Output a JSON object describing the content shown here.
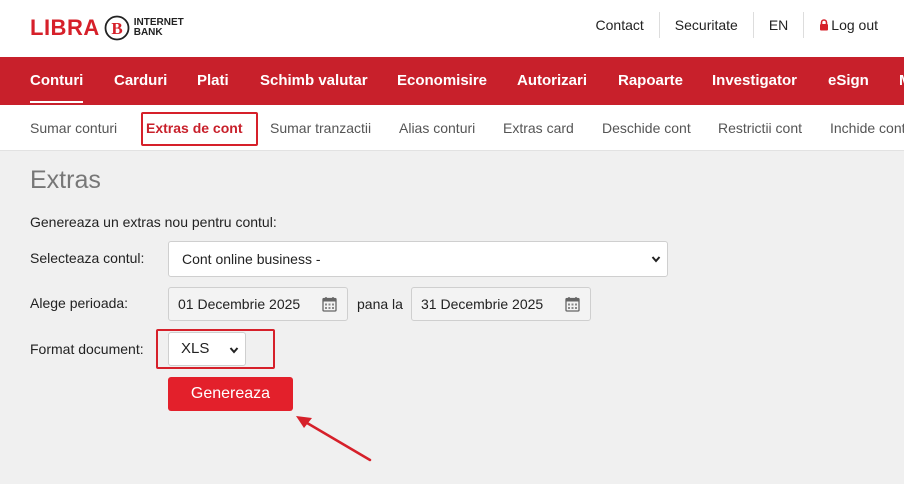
{
  "header": {
    "logo_word": "LIBRA",
    "logo_sub_line1": "INTERNET",
    "logo_sub_line2": "BANK",
    "links": [
      "Contact",
      "Securitate",
      "EN",
      "Log out"
    ]
  },
  "main_nav": {
    "items": [
      "Conturi",
      "Carduri",
      "Plati",
      "Schimb valutar",
      "Economisire",
      "Autorizari",
      "Rapoarte",
      "Investigator",
      "eSign",
      "M"
    ],
    "active": "Conturi"
  },
  "sub_nav": {
    "items": [
      "Sumar conturi",
      "Extras de cont",
      "Sumar tranzactii",
      "Alias conturi",
      "Extras card",
      "Deschide cont",
      "Restrictii cont",
      "Inchide cont"
    ],
    "active": "Extras de cont"
  },
  "page": {
    "title": "Extras",
    "intro": "Genereaza un extras nou pentru contul:",
    "account_label": "Selecteaza contul:",
    "account_value": "Cont online business -",
    "period_label": "Alege perioada:",
    "date_from": "01 Decembrie 2025",
    "between_label": "pana la",
    "date_to": "31 Decembrie 2025",
    "format_label": "Format document:",
    "format_value": "XLS",
    "generate_button": "Genereaza"
  },
  "colors": {
    "brand_red": "#c8202b",
    "button_red": "#e3202b",
    "highlight": "#d6202a"
  }
}
